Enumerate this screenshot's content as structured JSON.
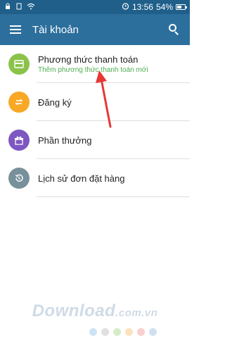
{
  "status_bar": {
    "time": "13:56",
    "battery": "54%",
    "battery_level": 0.54
  },
  "app_bar": {
    "title": "Tài khoản",
    "menu_icon": "menu-icon",
    "search_icon": "search-icon"
  },
  "items": [
    {
      "title": "Phương thức thanh toán",
      "subtitle": "Thêm phương thức thanh toán mới",
      "icon": "credit-card-icon",
      "color": "#8bc34a"
    },
    {
      "title": "Đăng ký",
      "icon": "swap-arrows-icon",
      "color": "#f9a825"
    },
    {
      "title": "Phần thưởng",
      "icon": "gift-icon",
      "color": "#7e57c2"
    },
    {
      "title": "Lịch sử đơn đặt hàng",
      "icon": "history-icon",
      "color": "#78909c"
    }
  ],
  "annotation_arrow_color": "#e53935",
  "watermark": {
    "brand": "Download",
    "domain": ".com.vn",
    "dot_colors": [
      "#cde4f4",
      "#e0e0e0",
      "#d6ecc8",
      "#fbe2bf",
      "#f8cfd0",
      "#cfe0f3"
    ]
  }
}
